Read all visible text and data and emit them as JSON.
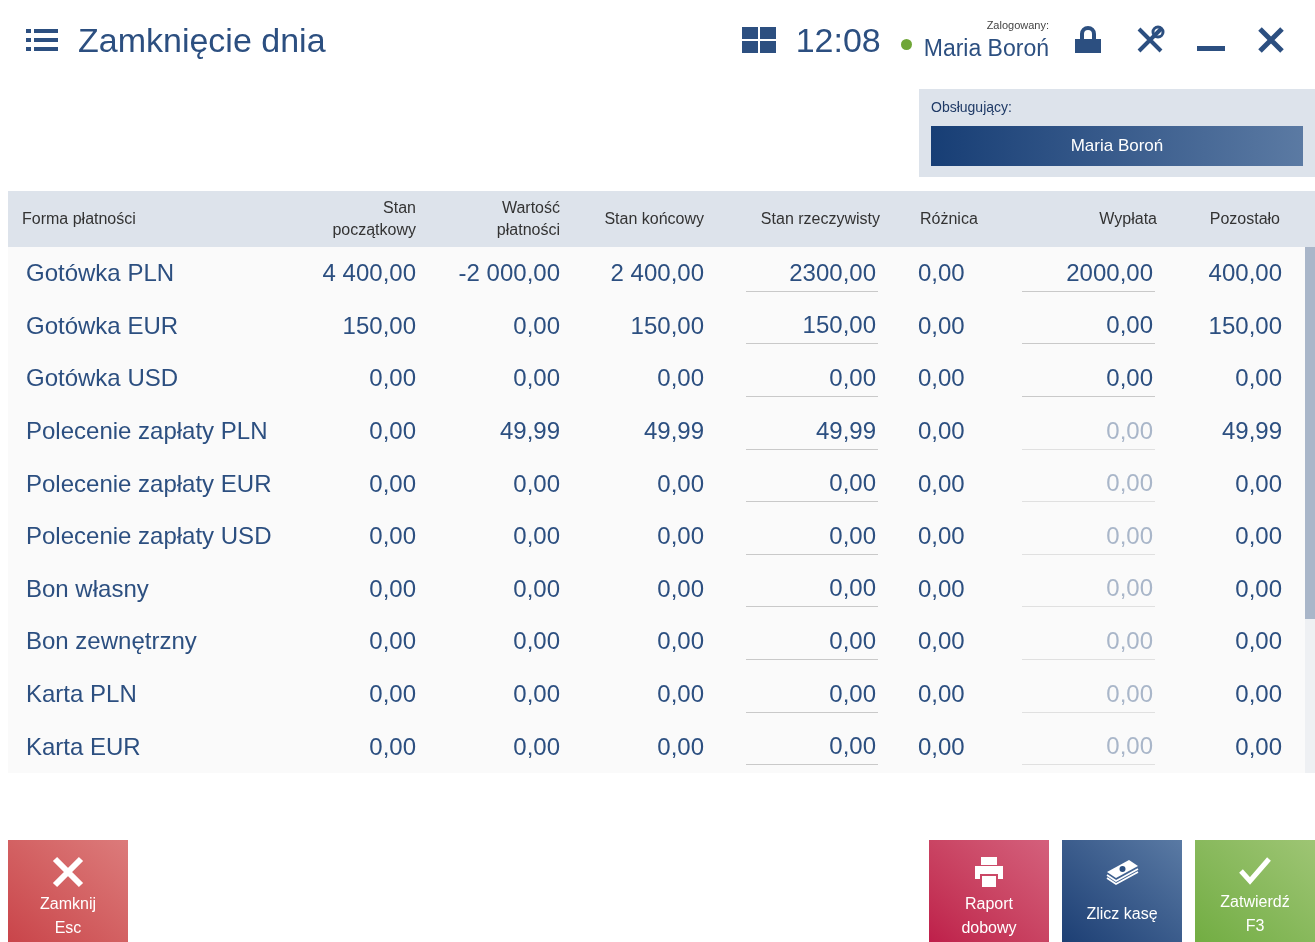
{
  "header": {
    "title": "Zamknięcie dnia",
    "time": "12:08",
    "logged_label": "Zalogowany:",
    "user": "Maria Boroń",
    "online": true
  },
  "operator": {
    "label": "Obsługujący:",
    "value": "Maria Boroń"
  },
  "table": {
    "columns": [
      "Forma płatności",
      "Stan początkowy",
      "Wartość płatności",
      "Stan końcowy",
      "Stan rzeczywisty",
      "Różnica",
      "Wypłata",
      "Pozostało"
    ],
    "rows": [
      {
        "name": "Gotówka PLN",
        "start": "4 400,00",
        "payments": "-2 000,00",
        "end": "2 400,00",
        "actual": "2300,00",
        "difference": "0,00",
        "payout": "2000,00",
        "payout_disabled": false,
        "remaining": "400,00"
      },
      {
        "name": "Gotówka EUR",
        "start": "150,00",
        "payments": "0,00",
        "end": "150,00",
        "actual": "150,00",
        "difference": "0,00",
        "payout": "0,00",
        "payout_disabled": false,
        "remaining": "150,00"
      },
      {
        "name": "Gotówka USD",
        "start": "0,00",
        "payments": "0,00",
        "end": "0,00",
        "actual": "0,00",
        "difference": "0,00",
        "payout": "0,00",
        "payout_disabled": false,
        "remaining": "0,00"
      },
      {
        "name": "Polecenie zapłaty PLN",
        "start": "0,00",
        "payments": "49,99",
        "end": "49,99",
        "actual": "49,99",
        "difference": "0,00",
        "payout": "0,00",
        "payout_disabled": true,
        "remaining": "49,99"
      },
      {
        "name": "Polecenie zapłaty EUR",
        "start": "0,00",
        "payments": "0,00",
        "end": "0,00",
        "actual": "0,00",
        "difference": "0,00",
        "payout": "0,00",
        "payout_disabled": true,
        "remaining": "0,00"
      },
      {
        "name": "Polecenie zapłaty USD",
        "start": "0,00",
        "payments": "0,00",
        "end": "0,00",
        "actual": "0,00",
        "difference": "0,00",
        "payout": "0,00",
        "payout_disabled": true,
        "remaining": "0,00"
      },
      {
        "name": "Bon własny",
        "start": "0,00",
        "payments": "0,00",
        "end": "0,00",
        "actual": "0,00",
        "difference": "0,00",
        "payout": "0,00",
        "payout_disabled": true,
        "remaining": "0,00"
      },
      {
        "name": "Bon zewnętrzny",
        "start": "0,00",
        "payments": "0,00",
        "end": "0,00",
        "actual": "0,00",
        "difference": "0,00",
        "payout": "0,00",
        "payout_disabled": true,
        "remaining": "0,00"
      },
      {
        "name": "Karta PLN",
        "start": "0,00",
        "payments": "0,00",
        "end": "0,00",
        "actual": "0,00",
        "difference": "0,00",
        "payout": "0,00",
        "payout_disabled": true,
        "remaining": "0,00"
      },
      {
        "name": "Karta EUR",
        "start": "0,00",
        "payments": "0,00",
        "end": "0,00",
        "actual": "0,00",
        "difference": "0,00",
        "payout": "0,00",
        "payout_disabled": true,
        "remaining": "0,00"
      }
    ]
  },
  "buttons": [
    {
      "kind": "close",
      "lines": [
        "Zamknij",
        "Esc"
      ]
    },
    {
      "kind": "report",
      "lines": [
        "Raport",
        "dobowy"
      ]
    },
    {
      "kind": "count",
      "lines": [
        "Zlicz kasę"
      ]
    },
    {
      "kind": "confirm",
      "lines": [
        "Zatwierdź",
        "F3"
      ]
    }
  ]
}
